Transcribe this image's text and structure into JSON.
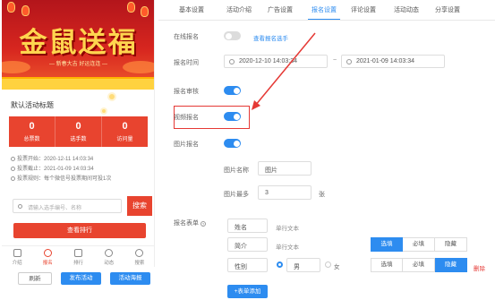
{
  "preview": {
    "banner_title": "金鼠送福",
    "banner_subtitle": "— 新春大吉 好运连连 —",
    "activity_title": "默认活动标题",
    "stats": [
      {
        "value": "0",
        "label": "总票数"
      },
      {
        "value": "0",
        "label": "选手数"
      },
      {
        "value": "0",
        "label": "访问量"
      }
    ],
    "info_lines": [
      "投票开始：2020-12-11 14:03:34",
      "投票截止：2021-01-09 14:03:34",
      "投票规则：每个微信号投票期间可投1次"
    ],
    "search_placeholder": "请输入选手编号、名称",
    "search_button": "搜索",
    "rank_button": "查看排行",
    "nav": [
      {
        "label": "介绍",
        "icon": "home-icon"
      },
      {
        "label": "报名",
        "icon": "signup-icon"
      },
      {
        "label": "排行",
        "icon": "rank-icon"
      },
      {
        "label": "动态",
        "icon": "activity-icon"
      },
      {
        "label": "搜索",
        "icon": "search-icon"
      }
    ]
  },
  "footer_buttons": {
    "refresh": "刷新",
    "publish": "发布活动",
    "poster": "活动海报"
  },
  "tabs": [
    {
      "label": "基本设置",
      "active": false
    },
    {
      "label": "活动介绍",
      "active": false
    },
    {
      "label": "广告设置",
      "active": false
    },
    {
      "label": "报名设置",
      "active": true
    },
    {
      "label": "评论设置",
      "active": false
    },
    {
      "label": "活动动态",
      "active": false
    },
    {
      "label": "分享设置",
      "active": false
    }
  ],
  "form": {
    "online_signup": {
      "label": "在线报名",
      "enabled": false,
      "link": "查看报名选手"
    },
    "signup_time": {
      "label": "报名时间",
      "start": "2020-12-10 14:03:34",
      "separator": "~",
      "end": "2021-01-09 14:03:34"
    },
    "signup_review": {
      "label": "报名审核",
      "enabled": true
    },
    "video_signup": {
      "label": "视频报名",
      "enabled": true
    },
    "image_signup": {
      "label": "图片报名",
      "enabled": true
    },
    "image_name": {
      "label": "图片名称",
      "value": "图片"
    },
    "image_max": {
      "label": "图片最多",
      "value": "3",
      "unit": "张"
    },
    "signup_form": {
      "label": "报名表单",
      "fields": [
        {
          "name": "姓名",
          "type": "单行文本"
        },
        {
          "name": "简介",
          "type": "单行文本",
          "required_options": [
            "选填",
            "必填",
            "隐藏"
          ],
          "selected": "选填"
        },
        {
          "name": "性别",
          "radio_options": [
            "男",
            "女"
          ],
          "radio_selected": "男",
          "required_options": [
            "选填",
            "必填",
            "隐藏"
          ],
          "selected": "隐藏",
          "delete": "删除"
        }
      ],
      "add_button": "+表单添加"
    }
  },
  "colors": {
    "accent": "#2d8cf0",
    "preview_red": "#e8442f",
    "highlight": "#e53935"
  }
}
